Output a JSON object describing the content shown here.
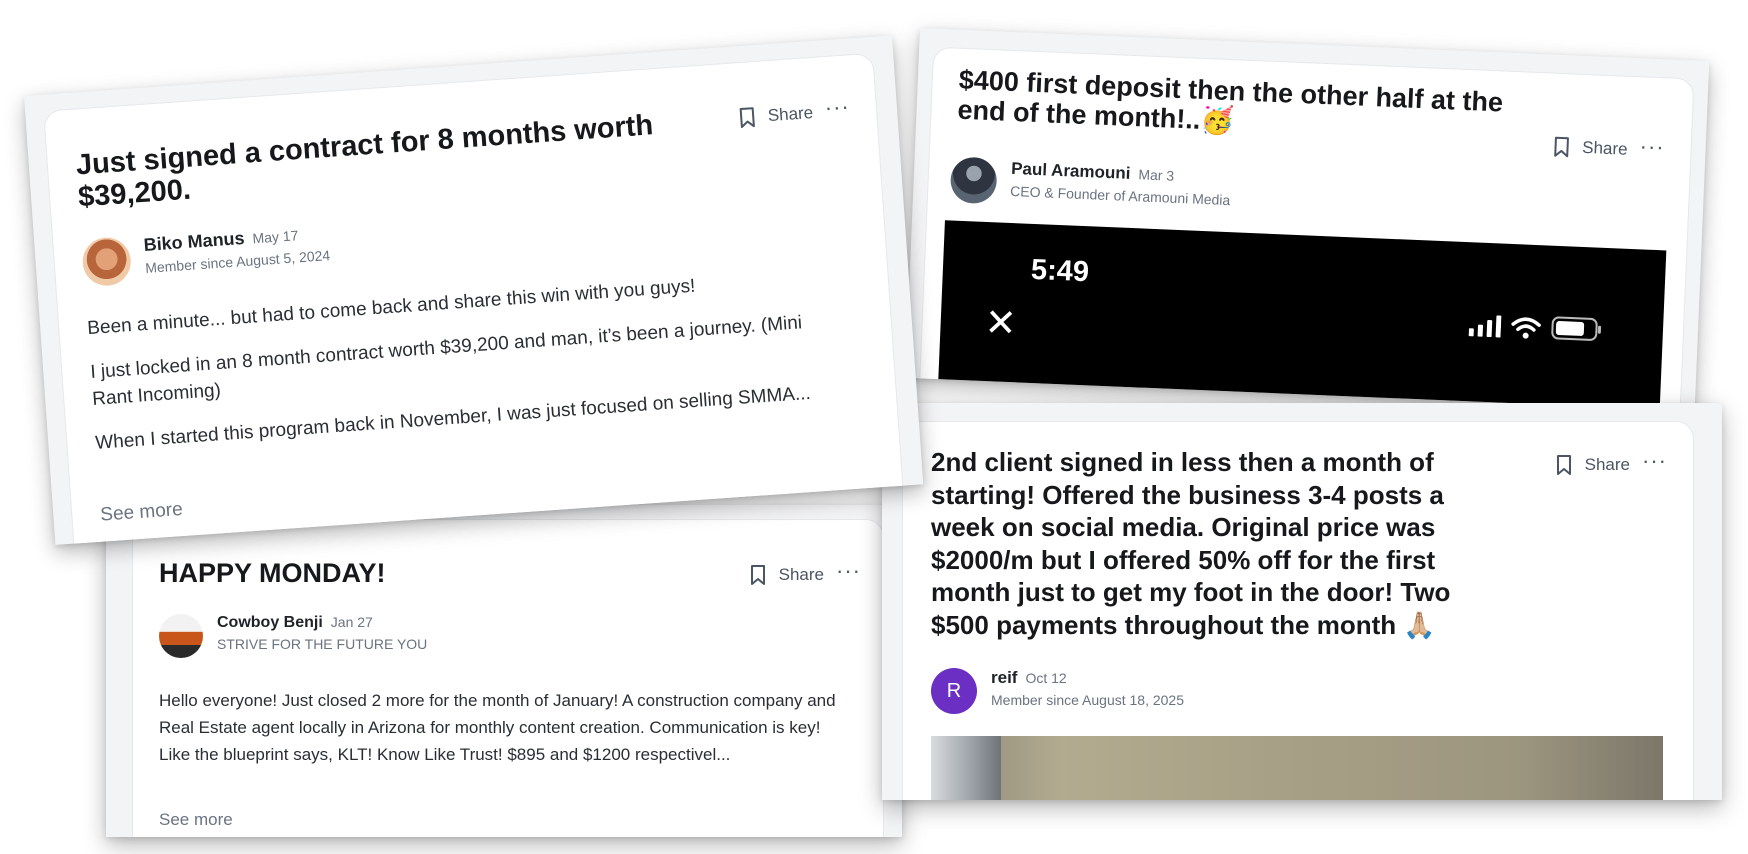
{
  "posts": {
    "contract": {
      "title": "Just signed a contract for 8 months worth $39,200.",
      "share": "Share",
      "more": "···",
      "author": "Biko Manus",
      "date": "May 17",
      "subtitle": "Member since August 5, 2024",
      "p1": "Been a minute... but had to come back and share this win with you guys!",
      "p2": "I just locked in an 8 month contract worth $39,200 and man, it’s been a journey. (Mini Rant Incoming)",
      "p3": "When I started this program back in November, I was just focused on selling SMMA...",
      "see_more": "See more"
    },
    "deposit": {
      "title": "$400 first deposit then the other half at the end of the month!..🥳",
      "share": "Share",
      "more": "···",
      "author": "Paul Aramouni",
      "date": "Mar 3",
      "subtitle": "CEO & Founder of Aramouni Media",
      "phone_time": "5:49",
      "close_glyph": "✕"
    },
    "monday": {
      "title": "HAPPY MONDAY!",
      "share": "Share",
      "more": "···",
      "author": "Cowboy Benji",
      "date": "Jan 27",
      "subtitle": "STRIVE FOR THE FUTURE YOU",
      "body": "Hello everyone! Just closed 2 more for the month of January! A construction company and Real Estate agent locally in Arizona for monthly content creation. Communication is key! Like the blueprint says, KLT! Know Like Trust! $895 and $1200 respectivel...",
      "see_more": "See more"
    },
    "client": {
      "title": "2nd client signed in less then a month of starting! Offered the business 3-4 posts a week on social media. Original price was $2000/m but I offered 50% off for the first month just to get my foot in the door! Two $500 payments throughout the month 🙏🏼",
      "share": "Share",
      "more": "···",
      "avatar_initial": "R",
      "author": "reif",
      "date": "Oct 12",
      "subtitle": "Member since August 18, 2025"
    }
  },
  "icons": {
    "bookmark": "bookmark-icon",
    "signal": "signal-icon",
    "wifi": "wifi-icon",
    "battery": "battery-icon",
    "close": "close-icon"
  },
  "colors": {
    "avatar_reif": "#6b2fc4",
    "phone_bg": "#000000"
  }
}
